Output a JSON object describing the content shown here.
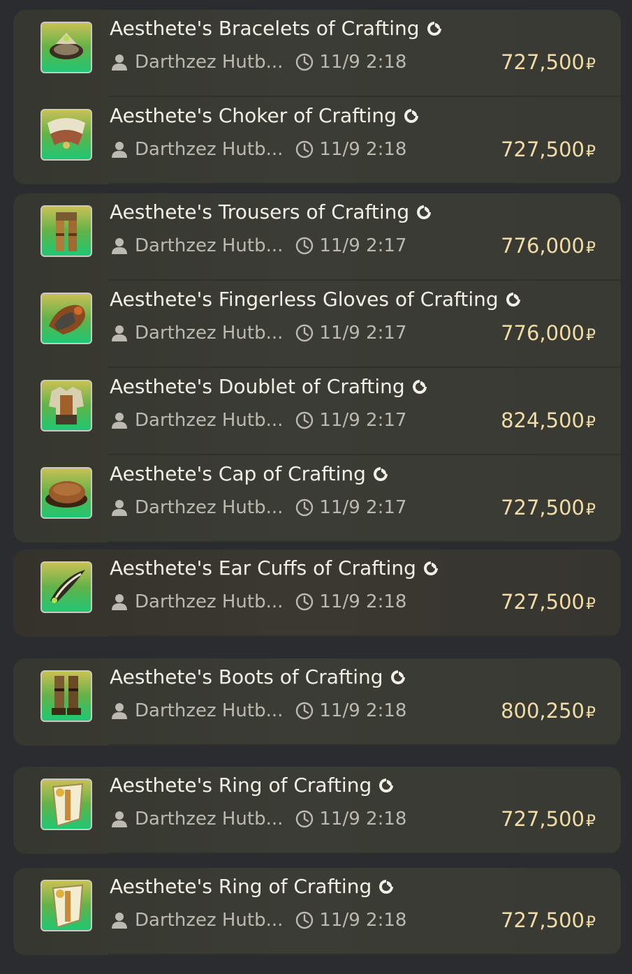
{
  "currency_symbol": "₽",
  "groups": [
    {
      "tint": false,
      "rows": [
        {
          "name": "Aesthete's Bracelets of Crafting",
          "seller": "Darthzez Hutb...",
          "time": "11/9 2:18",
          "price": "727,500",
          "icon": "bracelets-icon"
        },
        {
          "name": "Aesthete's Choker of Crafting",
          "seller": "Darthzez Hutb...",
          "time": "11/9 2:18",
          "price": "727,500",
          "icon": "choker-icon"
        }
      ]
    },
    {
      "tint": false,
      "rows": [
        {
          "name": "Aesthete's Trousers of Crafting",
          "seller": "Darthzez Hutb...",
          "time": "11/9 2:17",
          "price": "776,000",
          "icon": "trousers-icon"
        },
        {
          "name": "Aesthete's Fingerless Gloves of Crafting",
          "seller": "Darthzez Hutb...",
          "time": "11/9 2:17",
          "price": "776,000",
          "icon": "gloves-icon"
        },
        {
          "name": "Aesthete's Doublet of Crafting",
          "seller": "Darthzez Hutb...",
          "time": "11/9 2:17",
          "price": "824,500",
          "icon": "doublet-icon"
        },
        {
          "name": "Aesthete's Cap of Crafting",
          "seller": "Darthzez Hutb...",
          "time": "11/9 2:17",
          "price": "727,500",
          "icon": "cap-icon"
        }
      ]
    },
    {
      "tint": true,
      "rows": [
        {
          "name": "Aesthete's Ear Cuffs of Crafting",
          "seller": "Darthzez Hutb...",
          "time": "11/9 2:18",
          "price": "727,500",
          "icon": "ear-cuffs-icon"
        }
      ]
    },
    {
      "tint": false,
      "rows": [
        {
          "name": "Aesthete's Boots of Crafting",
          "seller": "Darthzez Hutb...",
          "time": "11/9 2:18",
          "price": "800,250",
          "icon": "boots-icon"
        }
      ]
    },
    {
      "tint": false,
      "rows": [
        {
          "name": "Aesthete's Ring of Crafting",
          "seller": "Darthzez Hutb...",
          "time": "11/9 2:18",
          "price": "727,500",
          "icon": "ring-icon"
        }
      ]
    },
    {
      "tint": false,
      "rows": [
        {
          "name": "Aesthete's Ring of Crafting",
          "seller": "Darthzez Hutb...",
          "time": "11/9 2:18",
          "price": "727,500",
          "icon": "ring-icon"
        }
      ]
    }
  ]
}
